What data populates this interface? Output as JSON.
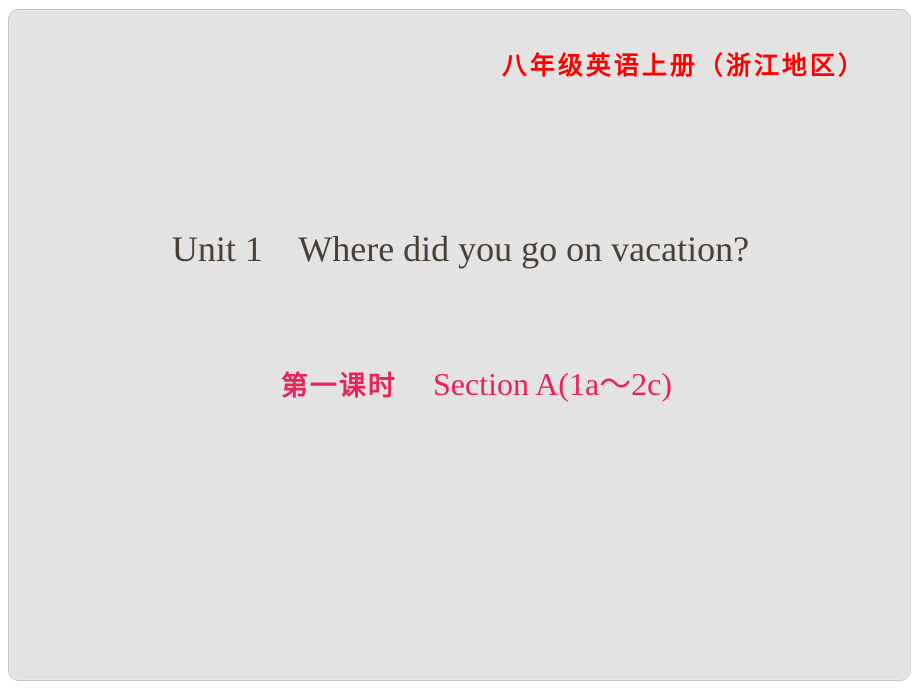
{
  "slide": {
    "header_title": "八年级英语上册（浙江地区）",
    "unit_title": "Unit 1    Where did you go on vacation?",
    "lesson_label": "第一课时",
    "section_label": "Section A(1a～2c)"
  },
  "colors": {
    "header": "#ff0000",
    "unit_title": "#4a3f35",
    "section": "#e8245a",
    "slide_background": "#e3e3e3"
  }
}
